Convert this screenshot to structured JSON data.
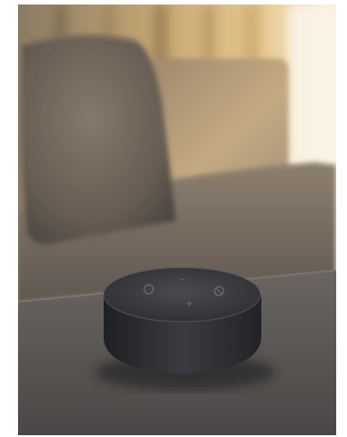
{
  "scene": {
    "subject": "smart-speaker",
    "colors": {
      "window_light": "#f3ead2",
      "curtain": "#d9b27a",
      "sofa_back": "#b7a081",
      "sofa_seat": "#6b625b",
      "table": "#5c5856",
      "pillow": "#756a5d",
      "speaker_fabric": "#2f2f33",
      "speaker_top": "#3b3c40"
    },
    "speaker_buttons": [
      "action-button",
      "volume-down-button",
      "volume-up-button",
      "mic-off-button"
    ]
  }
}
